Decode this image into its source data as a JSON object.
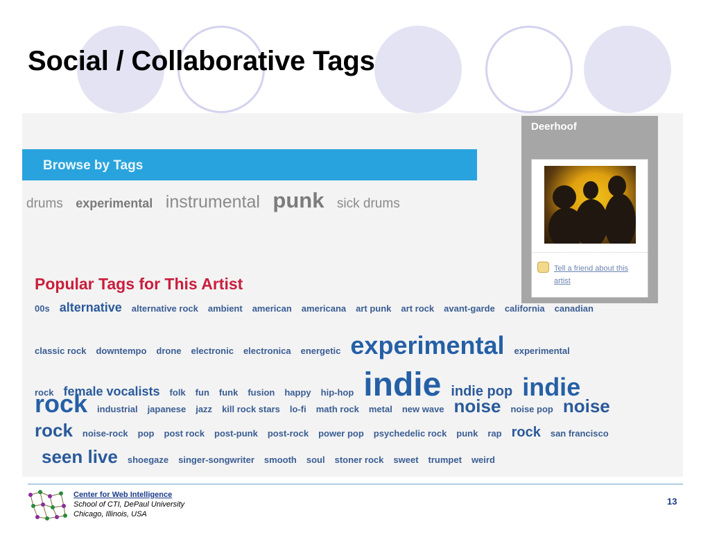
{
  "slide": {
    "title": "Social / Collaborative Tags"
  },
  "browse": {
    "header": "Browse by Tags",
    "tags": [
      "drums",
      "experimental",
      "instrumental",
      "punk",
      "sick drums"
    ]
  },
  "artist": {
    "name": "Deerhoof",
    "tell_friend": "Tell a friend about this artist",
    "icon": "speech-bubble-icon"
  },
  "popular": {
    "header": "Popular Tags for This Artist",
    "rows": [
      [
        "00s",
        "alternative",
        "alternative rock",
        "ambient",
        "american",
        "americana",
        "art punk",
        "art rock",
        "avant-garde",
        "california",
        "canadian"
      ],
      [
        "classic rock",
        "downtempo",
        "drone",
        "electronic",
        "electronica",
        "energetic",
        "experimental",
        "experimental"
      ],
      [
        "rock",
        "female vocalists",
        "folk",
        "fun",
        "funk",
        "fusion",
        "happy",
        "hip-hop",
        "indie",
        "indie pop",
        "indie"
      ],
      [
        "rock",
        "industrial",
        "japanese",
        "jazz",
        "kill rock stars",
        "lo-fi",
        "math rock",
        "metal",
        "new wave",
        "noise",
        "noise pop",
        "noise"
      ],
      [
        "rock",
        "noise-rock",
        "pop",
        "post rock",
        "post-punk",
        "post-rock",
        "power pop",
        "psychedelic rock",
        "punk",
        "rap",
        "rock",
        "san francisco"
      ],
      [
        "seen live",
        "shoegaze",
        "singer-songwriter",
        "smooth",
        "soul",
        "stoner rock",
        "sweet",
        "trumpet",
        "weird"
      ]
    ]
  },
  "footer": {
    "center": "Center for Web Intelligence",
    "school": "School of CTI, DePaul University",
    "city": "Chicago, Illinois, USA",
    "page": "13"
  },
  "colors": {
    "browse_bar": "#29a3dd",
    "popular_header": "#c81e3c",
    "tag_blue": "#2560a6",
    "deco_circle": "#e3e3f4"
  }
}
